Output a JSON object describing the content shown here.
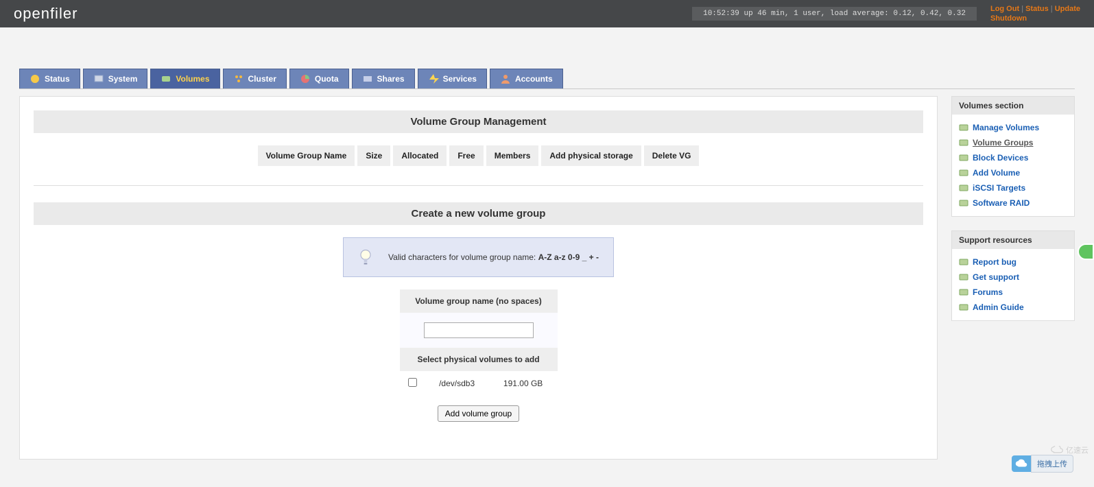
{
  "header": {
    "logo": "openfiler",
    "uptime": "10:52:39 up 46 min, 1 user, load average: 0.12, 0.42, 0.32",
    "links": {
      "logout": "Log Out",
      "status": "Status",
      "update": "Update",
      "shutdown": "Shutdown"
    }
  },
  "tabs": [
    {
      "id": "status",
      "label": "Status",
      "active": false
    },
    {
      "id": "system",
      "label": "System",
      "active": false
    },
    {
      "id": "volumes",
      "label": "Volumes",
      "active": true
    },
    {
      "id": "cluster",
      "label": "Cluster",
      "active": false
    },
    {
      "id": "quota",
      "label": "Quota",
      "active": false
    },
    {
      "id": "shares",
      "label": "Shares",
      "active": false
    },
    {
      "id": "services",
      "label": "Services",
      "active": false
    },
    {
      "id": "accounts",
      "label": "Accounts",
      "active": false
    }
  ],
  "main": {
    "vg_title": "Volume Group Management",
    "vg_columns": [
      "Volume Group Name",
      "Size",
      "Allocated",
      "Free",
      "Members",
      "Add physical storage",
      "Delete VG"
    ],
    "create_title": "Create a new volume group",
    "hint_prefix": "Valid characters for volume group name: ",
    "hint_bold": "A-Z a-z 0-9 _ + -",
    "name_label": "Volume group name (no spaces)",
    "name_value": "",
    "select_label": "Select physical volumes to add",
    "pv": {
      "checked": false,
      "device": "/dev/sdb3",
      "size": "191.00 GB"
    },
    "submit_label": "Add volume group"
  },
  "sidebar": {
    "volumes_title": "Volumes section",
    "volumes_items": [
      {
        "label": "Manage Volumes",
        "current": false
      },
      {
        "label": "Volume Groups",
        "current": true
      },
      {
        "label": "Block Devices",
        "current": false
      },
      {
        "label": "Add Volume",
        "current": false
      },
      {
        "label": "iSCSI Targets",
        "current": false
      },
      {
        "label": "Software RAID",
        "current": false
      }
    ],
    "support_title": "Support resources",
    "support_items": [
      {
        "label": "Report bug"
      },
      {
        "label": "Get support"
      },
      {
        "label": "Forums"
      },
      {
        "label": "Admin Guide"
      }
    ]
  },
  "footer": {
    "upload_label": "拖拽上传",
    "watermark": "亿速云"
  }
}
